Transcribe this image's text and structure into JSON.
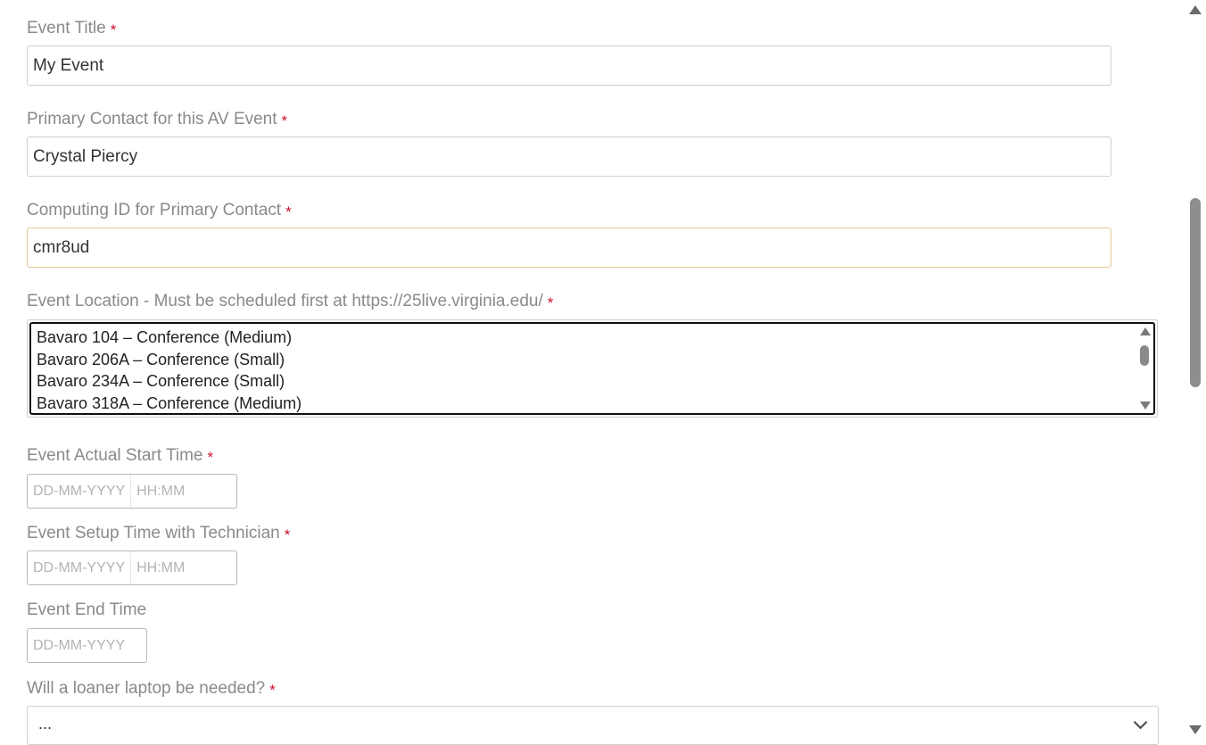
{
  "fields": {
    "event_title": {
      "label": "Event Title",
      "required": "*",
      "value": "My Event"
    },
    "primary_contact": {
      "label": "Primary Contact for this AV Event",
      "required": "*",
      "value": "Crystal Piercy"
    },
    "computing_id": {
      "label": "Computing ID for Primary Contact",
      "required": "*",
      "value": "cmr8ud"
    },
    "event_location": {
      "label": "Event Location - Must be scheduled first at https://25live.virginia.edu/",
      "required": "*",
      "options": [
        "Bavaro 104 – Conference (Medium)",
        "Bavaro 206A – Conference (Small)",
        "Bavaro 234A – Conference (Small)",
        "Bavaro 318A – Conference (Medium)"
      ]
    },
    "start_time": {
      "label": "Event Actual Start Time",
      "required": "*",
      "date_placeholder": "DD-MM-YYYY",
      "time_placeholder": "HH:MM"
    },
    "setup_time": {
      "label": "Event Setup Time with Technician",
      "required": "*",
      "date_placeholder": "DD-MM-YYYY",
      "time_placeholder": "HH:MM"
    },
    "end_time": {
      "label": "Event End Time",
      "date_placeholder": "DD-MM-YYYY"
    },
    "loaner_laptop": {
      "label": "Will a loaner laptop be needed?",
      "required": "*",
      "value": "..."
    }
  },
  "colors": {
    "label": "#8a8a8a",
    "required": "#c8102e",
    "focus_border": "#e6c697"
  }
}
